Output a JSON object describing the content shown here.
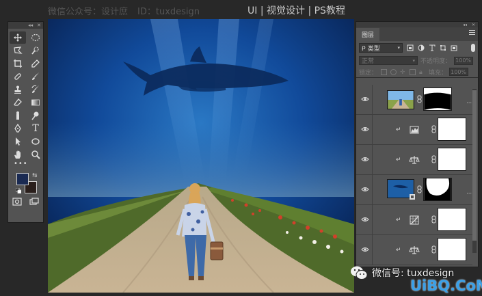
{
  "watermarks": {
    "top_left": "微信公众号：设计庶",
    "top_id": "ID：tuxdesign",
    "top_right": "UI | 视觉设计 | PS教程",
    "bottom_wechat": "微信号: tuxdesign",
    "bottom_site": "UiBQ.CoM"
  },
  "tools_panel": {
    "header_collapse": "◂◂",
    "header_close": "✕",
    "more_tools": "•••",
    "foreground_color": "#1a2a52",
    "background_color": "#2a1f1c",
    "tools": [
      {
        "id": "move",
        "icon": "move-icon",
        "active": true
      },
      {
        "id": "marquee",
        "icon": "elliptical-marquee-icon"
      },
      {
        "id": "lasso",
        "icon": "polygonal-lasso-icon"
      },
      {
        "id": "quick-select",
        "icon": "quick-selection-icon"
      },
      {
        "id": "crop",
        "icon": "crop-icon"
      },
      {
        "id": "eyedropper",
        "icon": "eyedropper-icon"
      },
      {
        "id": "healing",
        "icon": "healing-brush-icon"
      },
      {
        "id": "brush",
        "icon": "brush-icon"
      },
      {
        "id": "stamp",
        "icon": "clone-stamp-icon"
      },
      {
        "id": "history-brush",
        "icon": "history-brush-icon"
      },
      {
        "id": "eraser",
        "icon": "eraser-icon"
      },
      {
        "id": "gradient",
        "icon": "gradient-icon"
      },
      {
        "id": "smudge",
        "icon": "smudge-icon"
      },
      {
        "id": "dodge",
        "icon": "dodge-icon"
      },
      {
        "id": "pen",
        "icon": "pen-icon"
      },
      {
        "id": "type",
        "icon": "type-icon",
        "label": "T"
      },
      {
        "id": "path-select",
        "icon": "path-selection-icon"
      },
      {
        "id": "shape",
        "icon": "ellipse-shape-icon"
      },
      {
        "id": "hand",
        "icon": "hand-icon"
      },
      {
        "id": "zoom",
        "icon": "zoom-icon"
      }
    ]
  },
  "layers_panel": {
    "tab_label": "图层",
    "header_collapse": "◂◂",
    "header_close": "✕",
    "filter_prefix": "ρ",
    "filter_label": "类型",
    "blend_mode": "正常",
    "opacity_label": "不透明度：",
    "opacity_value": "100%",
    "lock_label": "锁定：",
    "fill_label": "填充：",
    "fill_value": "100%",
    "layers": [
      {
        "kind": "photo",
        "thumb": "girl-road",
        "mask": "sky-mask",
        "clipped": false,
        "more": "..."
      },
      {
        "kind": "adjustment",
        "adj_icon": "levels-icon",
        "clipped": true
      },
      {
        "kind": "adjustment",
        "adj_icon": "color-balance-icon",
        "clipped": true
      },
      {
        "kind": "photo",
        "thumb": "ocean-whale",
        "mask": "ocean-mask",
        "clipped": false,
        "more": "..."
      },
      {
        "kind": "adjustment",
        "adj_icon": "curves-grid-icon",
        "clipped": true
      },
      {
        "kind": "adjustment",
        "adj_icon": "color-balance-icon",
        "clipped": true
      }
    ]
  },
  "colors": {
    "app_bg": "#282828",
    "panel_bg": "#535353",
    "panel_header": "#3c3c3c",
    "accent_blue": "#3aa0e8"
  }
}
